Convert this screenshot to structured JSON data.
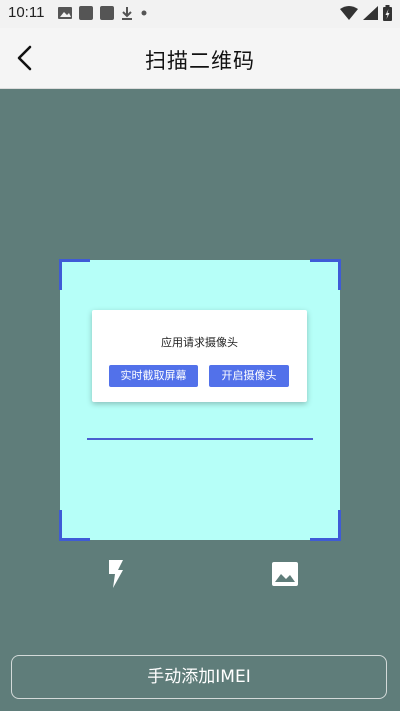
{
  "status_bar": {
    "time": "10:11",
    "left_icons": [
      "image-icon",
      "app-icon",
      "app-icon",
      "download-icon",
      "dot-icon"
    ],
    "right_icons": [
      "wifi-icon",
      "signal-icon",
      "battery-icon"
    ]
  },
  "header": {
    "title": "扫描二维码",
    "back_icon": "chevron-left-icon"
  },
  "dialog": {
    "message": "应用请求摄像头",
    "left_button": "实时截取屏幕",
    "right_button": "开启摄像头"
  },
  "toolbar": {
    "flash_icon": "flash-icon",
    "gallery_icon": "gallery-icon"
  },
  "footer": {
    "manual_button": "手动添加IMEI"
  },
  "colors": {
    "background": "#5f7d7a",
    "scan_area": "#b6fff8",
    "accent": "#4a5fcf",
    "button": "#5271ea"
  }
}
